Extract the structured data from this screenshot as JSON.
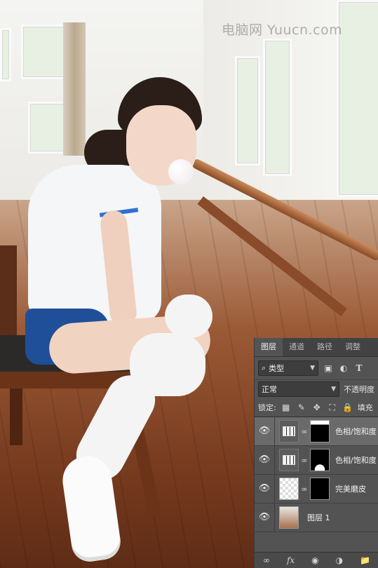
{
  "watermark": "电脑网 Yuucn.com",
  "panel": {
    "tabs": [
      {
        "label": "图层",
        "active": true
      },
      {
        "label": "通道",
        "active": false
      },
      {
        "label": "路径",
        "active": false
      },
      {
        "label": "调整",
        "active": false
      }
    ],
    "filter": {
      "kind_label": "类型",
      "search_icon": "search-icon"
    },
    "filter_icons": [
      "image-filter-icon",
      "adjustment-filter-icon",
      "type-filter-icon"
    ],
    "blend_mode": "正常",
    "opacity_label": "不透明度",
    "lock_label": "锁定:",
    "lock_icons": [
      "lock-transparent-icon",
      "lock-image-icon",
      "lock-position-icon",
      "lock-artboard-icon",
      "lock-all-icon"
    ],
    "fill_label": "填充",
    "layers": [
      {
        "name": "色相/饱和度",
        "type": "adjustment",
        "selected": true,
        "visible": true
      },
      {
        "name": "色相/饱和度",
        "type": "adjustment",
        "selected": false,
        "visible": true
      },
      {
        "name": "完美磨皮",
        "type": "smart-object",
        "selected": false,
        "visible": true
      },
      {
        "name": "图层 1",
        "type": "pixel",
        "selected": false,
        "visible": true
      }
    ],
    "bottom_icons": [
      "link-layers-icon",
      "fx-icon",
      "add-mask-icon",
      "new-adjustment-icon",
      "new-group-icon"
    ]
  }
}
